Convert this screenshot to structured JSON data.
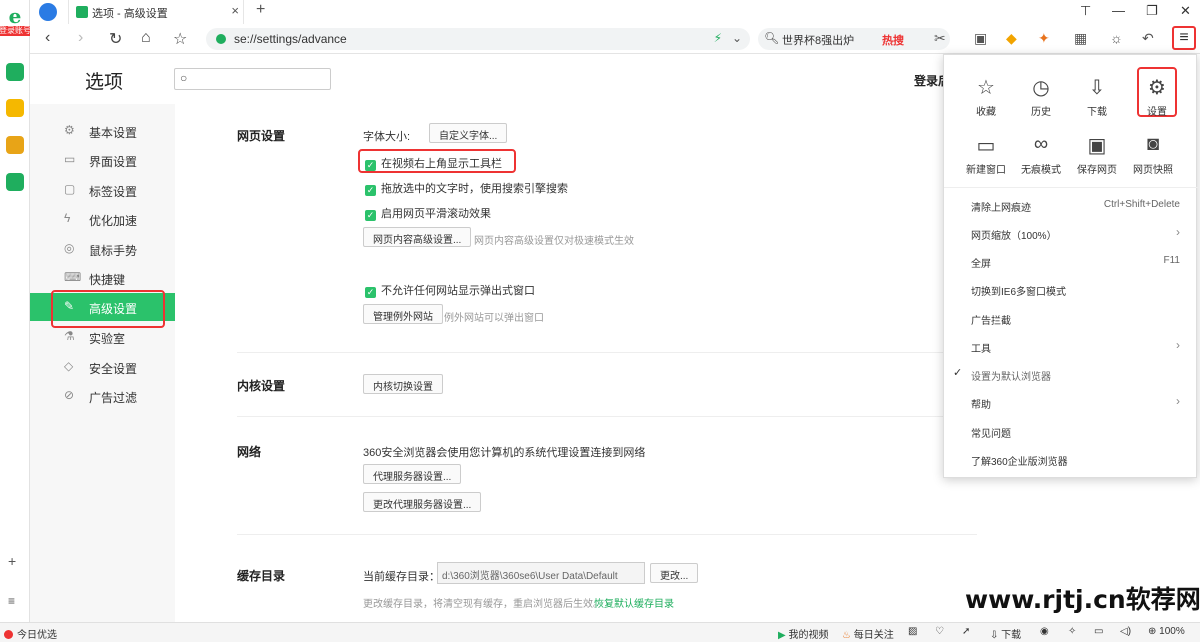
{
  "appbar": {
    "logo_letter": "e",
    "login_label": "登录账号"
  },
  "tab": {
    "title": "选项 - 高级设置",
    "close": "×",
    "new_tab": "+"
  },
  "window": {
    "pin": "⊤",
    "min": "—",
    "restore": "❐",
    "close": "✕"
  },
  "nav": {
    "url": "se://settings/advance",
    "search_text": "世界杯8强出炉",
    "hot_label": "热搜"
  },
  "page": {
    "title": "选项",
    "login_hint": "登录后"
  },
  "sidebar": {
    "items": [
      {
        "label": "基本设置",
        "icon": "gear-icon"
      },
      {
        "label": "界面设置",
        "icon": "window-icon"
      },
      {
        "label": "标签设置",
        "icon": "tab-icon"
      },
      {
        "label": "优化加速",
        "icon": "lightning-icon"
      },
      {
        "label": "鼠标手势",
        "icon": "mouse-icon"
      },
      {
        "label": "快捷键",
        "icon": "keyboard-icon"
      },
      {
        "label": "高级设置",
        "icon": "wrench-icon",
        "active": true
      },
      {
        "label": "实验室",
        "icon": "flask-icon"
      },
      {
        "label": "安全设置",
        "icon": "shield-icon"
      },
      {
        "label": "广告过滤",
        "icon": "block-icon"
      }
    ]
  },
  "webpage": {
    "section": "网页设置",
    "font_size_label": "字体大小:",
    "custom_font_button": "自定义字体...",
    "cb_video_toolbar": "在视频右上角显示工具栏",
    "cb_drag_search": "拖放选中的文字时，使用搜索引擎搜索",
    "cb_smooth_scroll": "启用网页平滑滚动效果",
    "advanced_content_button": "网页内容高级设置...",
    "advanced_content_hint": "网页内容高级设置仅对极速模式生效",
    "cb_block_popups": "不允许任何网站显示弹出式窗口",
    "manage_exceptions_button": "管理例外网站",
    "manage_exceptions_hint": "例外网站可以弹出窗口"
  },
  "kernel": {
    "section": "内核设置",
    "switch_button": "内核切换设置"
  },
  "network": {
    "section": "网络",
    "desc": "360安全浏览器会使用您计算机的系统代理设置连接到网络",
    "proxy_button": "代理服务器设置...",
    "change_proxy_button": "更改代理服务器设置..."
  },
  "cache": {
    "section": "缓存目录",
    "current_label": "当前缓存目录：",
    "path": "d:\\360浏览器\\360se6\\User Data\\Default",
    "change_button": "更改...",
    "hint": "更改缓存目录，将清空现有缓存，重启浏览器后生效。",
    "restore_link": "恢复默认缓存目录"
  },
  "menu": {
    "quick": [
      {
        "label": "收藏",
        "icon": "star-icon"
      },
      {
        "label": "历史",
        "icon": "clock-icon"
      },
      {
        "label": "下载",
        "icon": "download-icon"
      },
      {
        "label": "设置",
        "icon": "settings-icon"
      },
      {
        "label": "新建窗口",
        "icon": "new-window-icon"
      },
      {
        "label": "无痕模式",
        "icon": "incognito-icon"
      },
      {
        "label": "保存网页",
        "icon": "save-icon"
      },
      {
        "label": "网页快照",
        "icon": "camera-icon"
      }
    ],
    "items": [
      {
        "label": "清除上网痕迹",
        "shortcut": "Ctrl+Shift+Delete"
      },
      {
        "label": "网页缩放（100%）",
        "arrow": "›"
      },
      {
        "label": "全屏",
        "shortcut": "F11"
      },
      {
        "label": "切换到IE6多窗口模式"
      },
      {
        "label": "广告拦截"
      },
      {
        "label": "工具",
        "arrow": "›"
      },
      {
        "label": "设置为默认浏览器",
        "check": "✓"
      },
      {
        "label": "帮助",
        "arrow": "›"
      },
      {
        "label": "常见问题"
      },
      {
        "label": "了解360企业版浏览器"
      }
    ]
  },
  "status": {
    "daily": "今日优选",
    "my_video": "我的视频",
    "daily_follow": "每日关注",
    "download": "下载",
    "zoom": "100%"
  },
  "watermark": "www.rjtj.cn软荐网",
  "colors": {
    "accent": "#2bc26b",
    "highlight": "#ee3333"
  }
}
